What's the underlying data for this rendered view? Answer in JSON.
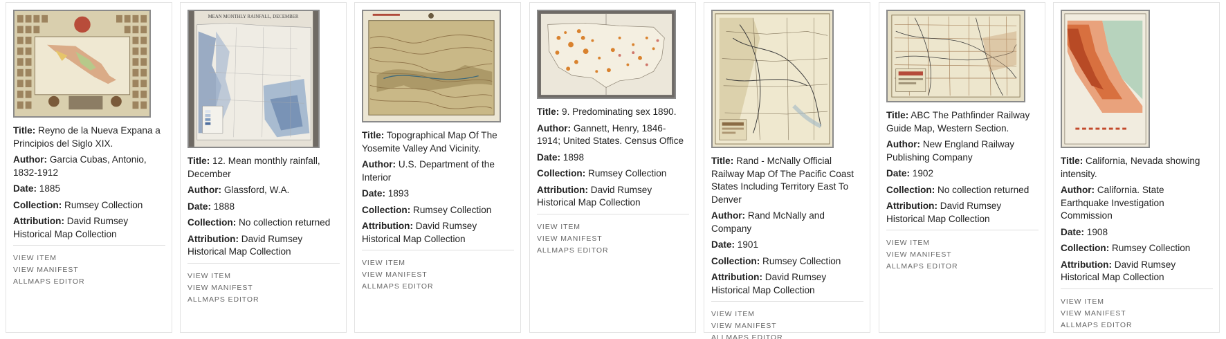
{
  "labels": {
    "title": "Title:",
    "author": "Author:",
    "date": "Date:",
    "collection": "Collection:",
    "attribution": "Attribution:"
  },
  "actions": {
    "view_item": "VIEW ITEM",
    "view_manifest": "VIEW MANIFEST",
    "allmaps_editor": "ALLMAPS EDITOR"
  },
  "items": [
    {
      "title": "Reyno de la Nueva Expana a Principios del Siglo XIX.",
      "author": "Garcia Cubas, Antonio, 1832-1912",
      "date": "1885",
      "collection": "Rumsey Collection",
      "attribution": "David Rumsey Historical Map Collection",
      "thumb_icon": "map-of-mexico-with-portraits-thumbnail"
    },
    {
      "title": "12. Mean monthly rainfall, December",
      "author": "Glassford, W.A.",
      "date": "1888",
      "collection": "No collection returned",
      "attribution": "David Rumsey Historical Map Collection",
      "thumb_icon": "rainfall-map-thumbnail",
      "thumb_heading": "MEAN MONTHLY RAINFALL, DECEMBER"
    },
    {
      "title": "Topographical Map Of The Yosemite Valley And Vicinity.",
      "author": "U.S. Department of the Interior",
      "date": "1893",
      "collection": "Rumsey Collection",
      "attribution": "David Rumsey Historical Map Collection",
      "thumb_icon": "yosemite-topographic-map-thumbnail"
    },
    {
      "title": "9. Predominating sex 1890.",
      "author": "Gannett, Henry, 1846-1914; United States. Census Office",
      "date": "1898",
      "collection": "Rumsey Collection",
      "attribution": "David Rumsey Historical Map Collection",
      "thumb_icon": "us-census-map-thumbnail"
    },
    {
      "title": "Rand - McNally Official Railway Map Of The Pacific Coast States Including Territory East To Denver",
      "author": "Rand McNally and Company",
      "date": "1901",
      "collection": "Rumsey Collection",
      "attribution": "David Rumsey Historical Map Collection",
      "thumb_icon": "pacific-railway-map-thumbnail"
    },
    {
      "title": "ABC The Pathfinder Railway Guide Map, Western Section.",
      "author": "New England Railway Publishing Company",
      "date": "1902",
      "collection": "No collection returned",
      "attribution": "David Rumsey Historical Map Collection",
      "thumb_icon": "railway-guide-map-thumbnail"
    },
    {
      "title": "California, Nevada showing intensity.",
      "author": "California. State Earthquake Investigation Commission",
      "date": "1908",
      "collection": "Rumsey Collection",
      "attribution": "David Rumsey Historical Map Collection",
      "thumb_icon": "earthquake-intensity-map-thumbnail"
    }
  ],
  "colors": {
    "label_text": "#222222",
    "action_text": "#666666",
    "card_border": "#e2e2e2",
    "thumb_border": "#8a8a8a"
  }
}
